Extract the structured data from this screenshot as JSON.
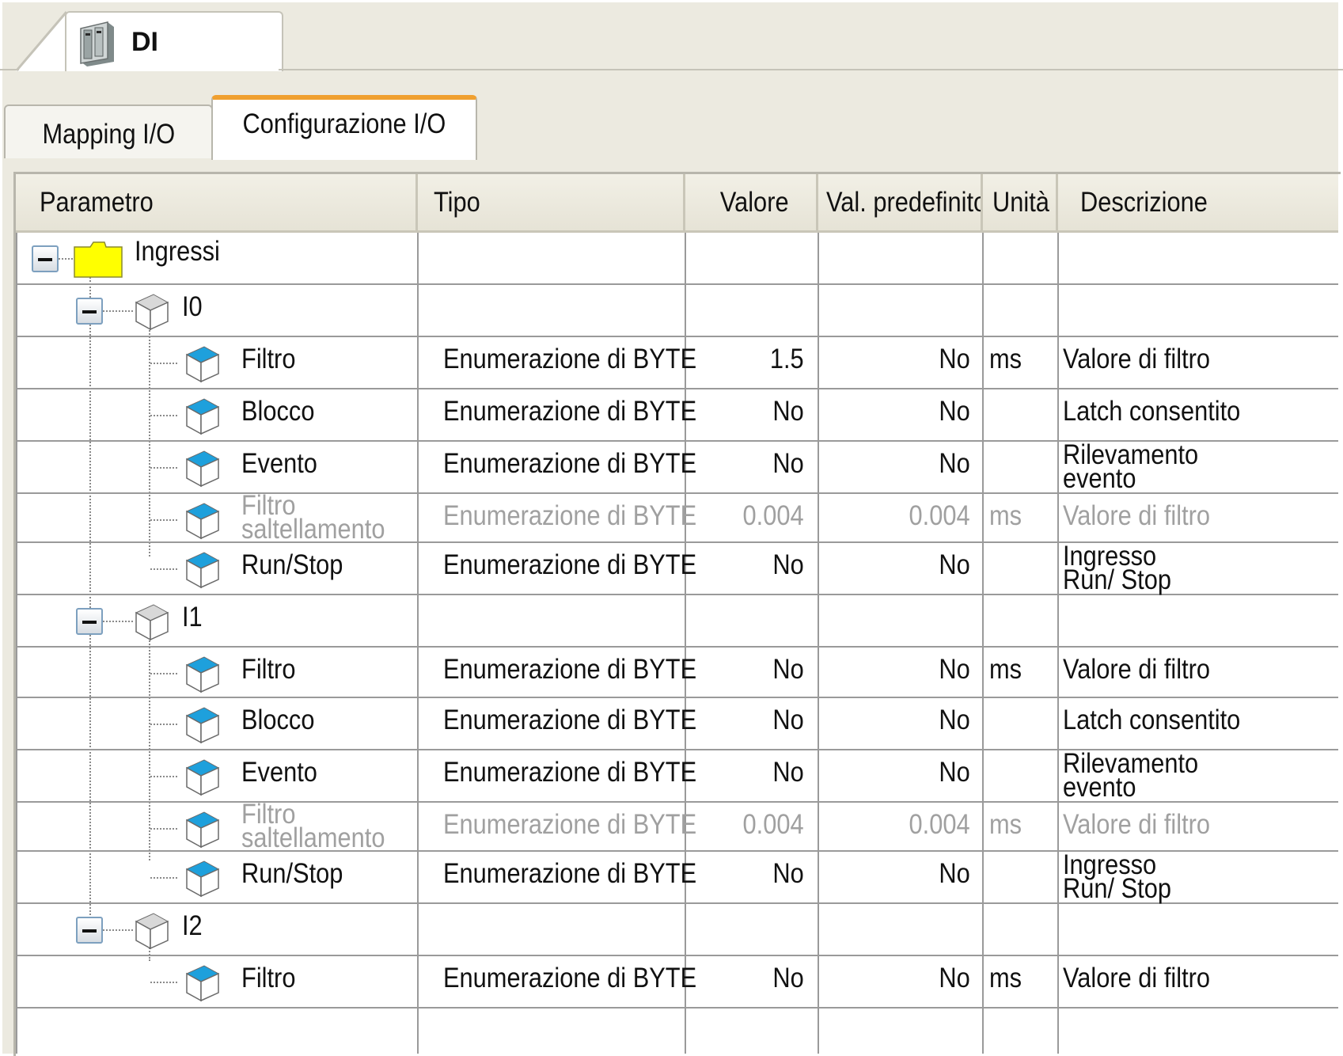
{
  "document_tab": {
    "title": "DI",
    "icon": "device-rack-icon"
  },
  "editor_tabs": [
    {
      "label": "Mapping I/O",
      "active": false
    },
    {
      "label": "Configurazione I/O",
      "active": true
    }
  ],
  "table": {
    "columns": [
      "Parametro",
      "Tipo",
      "Valore",
      "Val. predefinito",
      "Unità",
      "Descrizione"
    ],
    "root": {
      "label": "Ingressi",
      "icon": "folder-icon",
      "expanded": true
    },
    "channels": [
      {
        "label": "I0",
        "icon": "channel-cube-icon",
        "expanded": true,
        "params": [
          {
            "name": "Filtro",
            "tipo": "Enumerazione di BYTE",
            "valore": "1.5",
            "predefinito": "No",
            "unita": "ms",
            "descrizione": "Valore di filtro",
            "enabled": true
          },
          {
            "name": "Blocco",
            "tipo": "Enumerazione di BYTE",
            "valore": "No",
            "predefinito": "No",
            "unita": "",
            "descrizione": "Latch consentito",
            "enabled": true
          },
          {
            "name": "Evento",
            "tipo": "Enumerazione di BYTE",
            "valore": "No",
            "predefinito": "No",
            "unita": "",
            "descrizione": "Rilevamento evento",
            "enabled": true
          },
          {
            "name": "Filtro saltellamento",
            "tipo": "Enumerazione di BYTE",
            "valore": "0.004",
            "predefinito": "0.004",
            "unita": "ms",
            "descrizione": "Valore di filtro",
            "enabled": false
          },
          {
            "name": "Run/Stop",
            "tipo": "Enumerazione di BYTE",
            "valore": "No",
            "predefinito": "No",
            "unita": "",
            "descrizione": "Ingresso Run/ Stop",
            "enabled": true
          }
        ]
      },
      {
        "label": "I1",
        "icon": "channel-cube-icon",
        "expanded": true,
        "params": [
          {
            "name": "Filtro",
            "tipo": "Enumerazione di BYTE",
            "valore": "No",
            "predefinito": "No",
            "unita": "ms",
            "descrizione": "Valore di filtro",
            "enabled": true
          },
          {
            "name": "Blocco",
            "tipo": "Enumerazione di BYTE",
            "valore": "No",
            "predefinito": "No",
            "unita": "",
            "descrizione": "Latch consentito",
            "enabled": true
          },
          {
            "name": "Evento",
            "tipo": "Enumerazione di BYTE",
            "valore": "No",
            "predefinito": "No",
            "unita": "",
            "descrizione": "Rilevamento evento",
            "enabled": true
          },
          {
            "name": "Filtro saltellamento",
            "tipo": "Enumerazione di BYTE",
            "valore": "0.004",
            "predefinito": "0.004",
            "unita": "ms",
            "descrizione": "Valore di filtro",
            "enabled": false
          },
          {
            "name": "Run/Stop",
            "tipo": "Enumerazione di BYTE",
            "valore": "No",
            "predefinito": "No",
            "unita": "",
            "descrizione": "Ingresso Run/ Stop",
            "enabled": true
          }
        ]
      },
      {
        "label": "I2",
        "icon": "channel-cube-icon",
        "expanded": true,
        "params": [
          {
            "name": "Filtro",
            "tipo": "Enumerazione di BYTE",
            "valore": "No",
            "predefinito": "No",
            "unita": "ms",
            "descrizione": "Valore di filtro",
            "enabled": true
          }
        ]
      }
    ]
  },
  "colors": {
    "background": "#eceae0",
    "active_tab_accent": "#f0a030",
    "folder": "#ffff00",
    "param_cube": "#1ea0dc",
    "disabled_text": "#a0a0a0"
  }
}
